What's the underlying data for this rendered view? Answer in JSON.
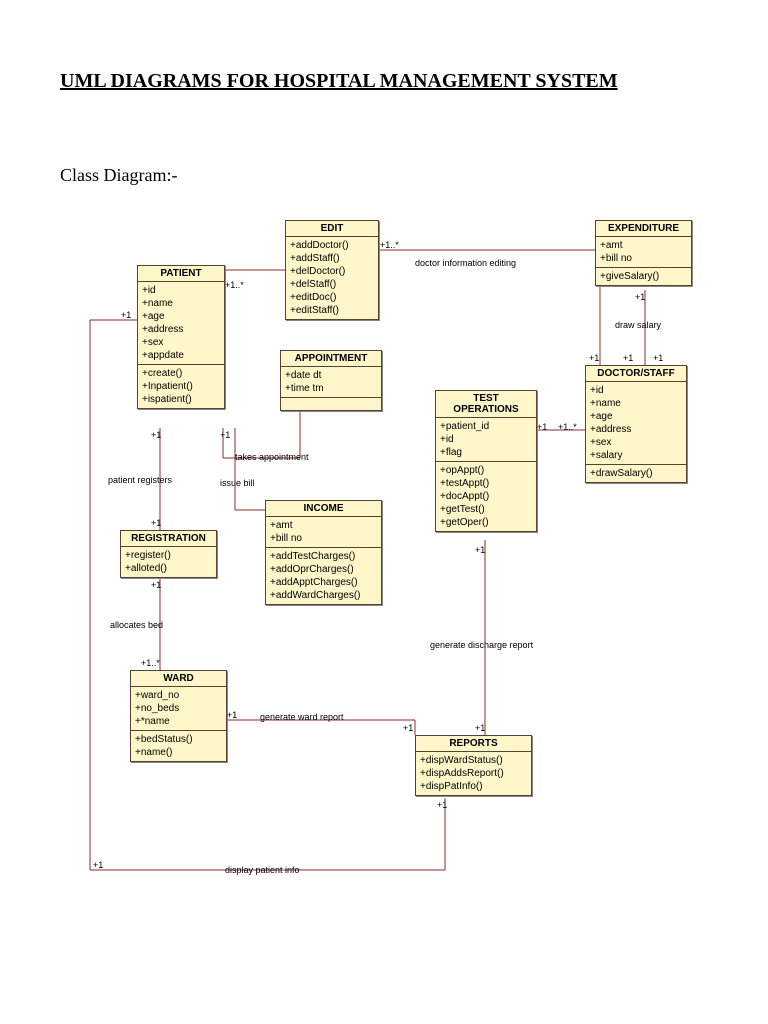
{
  "title": "UML DIAGRAMS FOR HOSPITAL MANAGEMENT SYSTEM",
  "subtitle": "Class Diagram:-",
  "classes": {
    "patient": {
      "name": "PATIENT",
      "attrs": [
        "+id",
        "+name",
        "+age",
        "+address",
        "+sex",
        "+appdate"
      ],
      "ops": [
        "+create()",
        "+Inpatient()",
        "+ispatient()"
      ]
    },
    "edit": {
      "name": "EDIT",
      "attrs": [],
      "ops": [
        "+addDoctor()",
        "+addStaff()",
        "+delDoctor()",
        "+delStaff()",
        "+editDoc()",
        "+editStaff()"
      ]
    },
    "expenditure": {
      "name": "EXPENDITURE",
      "attrs": [
        "+amt",
        "+bill no"
      ],
      "ops": [
        "+giveSalary()"
      ]
    },
    "appointment": {
      "name": "APPOINTMENT",
      "attrs": [
        "+date dt",
        "+time tm"
      ],
      "ops": []
    },
    "testops": {
      "name": "TEST OPERATIONS",
      "attrs": [
        "+patient_id",
        "+id",
        "+flag"
      ],
      "ops": [
        "+opAppt()",
        "+testAppt()",
        "+docAppt()",
        "+getTest()",
        "+getOper()"
      ]
    },
    "doctor": {
      "name": "DOCTOR/STAFF",
      "attrs": [
        "+id",
        "+name",
        "+age",
        "+address",
        "+sex",
        "+salary"
      ],
      "ops": [
        "+drawSalary()"
      ]
    },
    "registration": {
      "name": "REGISTRATION",
      "attrs": [],
      "ops": [
        "+register()",
        "+alloted()"
      ]
    },
    "income": {
      "name": "INCOME",
      "attrs": [
        "+amt",
        "+bill no"
      ],
      "ops": [
        "+addTestCharges()",
        "+addOprCharges()",
        "+addApptCharges()",
        "+addWardCharges()"
      ]
    },
    "ward": {
      "name": "WARD",
      "attrs": [
        "+ward_no",
        "+no_beds",
        "+*name"
      ],
      "ops": [
        "+bedStatus()",
        "+name()"
      ]
    },
    "reports": {
      "name": "REPORTS",
      "attrs": [],
      "ops": [
        "+dispWardStatus()",
        "+dispAddsReport()",
        "+dispPatInfo()"
      ]
    }
  },
  "labels": {
    "doctor_info_editing": "doctor information editing",
    "draw_salary": "draw salary",
    "takes_appointment": "takes appointment",
    "patient_registers": "patient registers",
    "issue_bill": "issue bill",
    "allocates_bed": "allocates bed",
    "generate_ward_report": "generate ward report",
    "generate_discharge_report": "generate discharge report",
    "display_patient_info": "display patient info"
  },
  "mult": {
    "p1": "+1",
    "p1s": "+1..*",
    "one": "+1",
    "one_star": "+1..*"
  }
}
